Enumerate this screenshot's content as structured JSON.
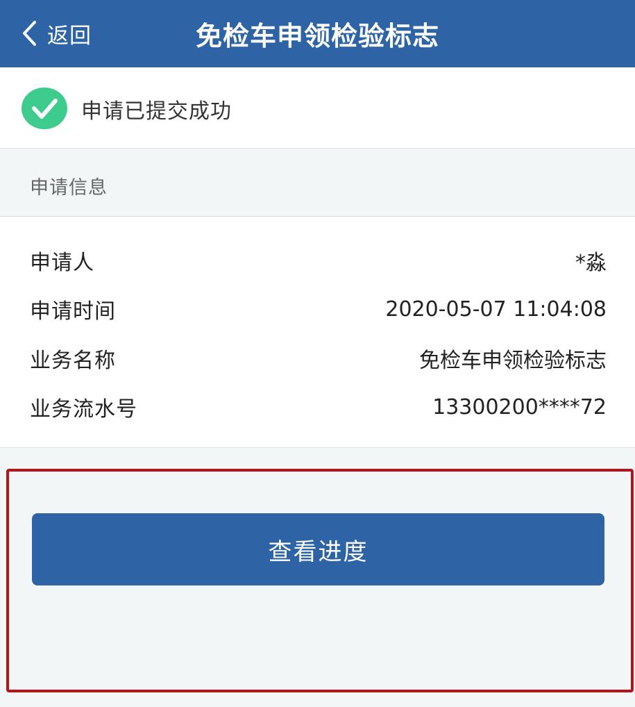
{
  "header": {
    "back_label": "返回",
    "title": "免检车申领检验标志"
  },
  "status": {
    "message": "申请已提交成功",
    "icon": "check-circle-icon",
    "icon_color": "#3dcc8e"
  },
  "section": {
    "title": "申请信息"
  },
  "info": {
    "rows": [
      {
        "label": "申请人",
        "value": "*淼"
      },
      {
        "label": "申请时间",
        "value": "2020-05-07 11:04:08"
      },
      {
        "label": "业务名称",
        "value": "免检车申领检验标志"
      },
      {
        "label": "业务流水号",
        "value": "13300200****72"
      }
    ]
  },
  "actions": {
    "progress_label": "查看进度"
  },
  "colors": {
    "primary": "#2e64a6",
    "highlight_border": "#b5121b",
    "background": "#f3f6f6"
  }
}
